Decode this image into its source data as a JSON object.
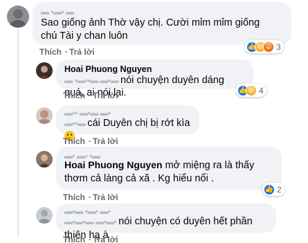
{
  "actions": {
    "like": "Thích",
    "reply": "Trả lời",
    "sep": "·"
  },
  "comments": [
    {
      "author": "",
      "text": "Sao giống ảnh Thờ vậy chị. Cười mỉm mỉm giống chú Tài y chan luôn",
      "reactions": [
        "like",
        "haha",
        "angry"
      ],
      "reaction_count": "3"
    },
    {
      "author": "Hoai Phuong Nguyen",
      "text": "nói chuyện duyên dáng quá, ai nói lại.",
      "reactions": [
        "like",
        "haha"
      ],
      "reaction_count": "4"
    },
    {
      "author": "",
      "text": "cái Duyên chị bị rớt kìa",
      "emoji": "smile-emoji"
    },
    {
      "author": "Hoai Phuong Nguyen",
      "text": "mở miệng ra là thấy thơm cả làng cả xã . Kg hiểu nổi .",
      "reactions": [
        "like"
      ],
      "reaction_count": "2"
    },
    {
      "author": "",
      "text": "nói chuyện có duyên hết phần thiên hạ à"
    }
  ],
  "colors": {
    "bubble": "#f0f2f5",
    "like": "#1877f2",
    "haha": "#f7b125",
    "angry": "#e9710f",
    "meta": "#65676b"
  }
}
